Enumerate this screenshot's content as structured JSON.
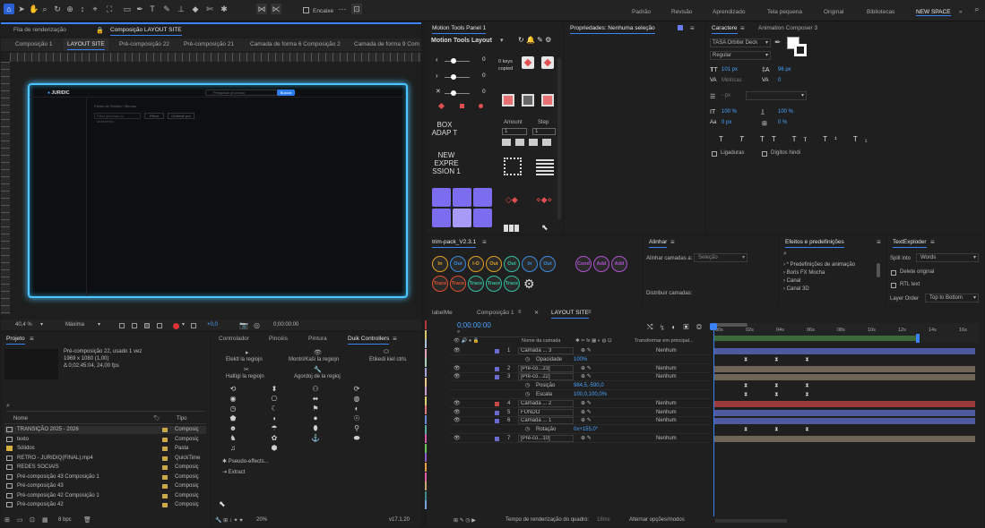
{
  "toolbar": {
    "snap_label": "Encaixe"
  },
  "workspaces": [
    "Padrão",
    "Revisão",
    "Aprendizado",
    "Tela pequena",
    "Original",
    "Bibliotecas",
    "NEW SPACE"
  ],
  "comp_panel": {
    "tabs": [
      "Fila de renderização",
      "Composição LAYOUT SITE"
    ],
    "subtabs": [
      "Composição 1",
      "LAYOUT SITE",
      "Pré-composição 22",
      "Pré-composição 21",
      "Camada de forma 6 Composição 2",
      "Camada de forma 9 Com"
    ],
    "zoom": "40,4 %",
    "resolution": "Máxima",
    "timecode": "0;00:00:00",
    "plus_value": "+0,0",
    "site": {
      "logo": "JURIDIC",
      "search_placeholder": "Pesquisar processo",
      "btn": "Buscar",
      "crumb1": "Painel de Gestão",
      "crumb2": "Minhas",
      "filter_input": "Filtrar (processo ou Andamento)",
      "filter_btn": "Filtrar",
      "order_btn": "Ordenar por"
    }
  },
  "motion_tools": {
    "tab": "Motion Tools Panel 1",
    "title": "Motion Tools Layout",
    "keys_label": "0 keys copied",
    "vals": [
      "0",
      "0",
      "0"
    ],
    "box_adapt": "BOX ADAP T",
    "new_expr": "NEW EXPRE SSION 1",
    "amount": "Amount",
    "step": "Step",
    "amount_val": "1",
    "step_val": "1"
  },
  "properties": {
    "tab": "Propriedades: Nenhuma seleção"
  },
  "character": {
    "tabs": [
      "Caractere",
      "Animation Composer 3"
    ],
    "font": "TASA Orbiter Deck",
    "style": "Regular",
    "size": "101 px",
    "leading": "96 px",
    "kerning": "Métricas",
    "tracking": "0",
    "stroke": "- px",
    "vscale": "100 %",
    "hscale": "100 %",
    "baseline": "0 px",
    "tsume": "0 %",
    "ligatures": "Ligaduras",
    "hindi": "Dígitos hindi"
  },
  "trim": {
    "tab": "trim-pack_V2.3.1",
    "buttons": [
      "In",
      "Out",
      "I-O",
      "Out",
      "Out",
      "In",
      "Out",
      "",
      "Cond",
      "Add",
      "Add",
      "Trace",
      "Trace",
      "Trace",
      "Trace",
      "Trace"
    ]
  },
  "align": {
    "tab": "Alinhar",
    "align_to_label": "Alinhar camadas a:",
    "align_to_value": "Seleção",
    "distribute": "Distribuir camadas:"
  },
  "effects": {
    "tab": "Efeitos e predefinições",
    "items": [
      "* Predefinições de animação",
      "Boris FX Mocha",
      "Canal",
      "Canal 3D"
    ]
  },
  "textexploder": {
    "tab": "TextExploder",
    "split_label": "Split into",
    "split_value": "Words",
    "delete_original": "Delete original",
    "rtl": "RTL text",
    "layer_order_label": "Layer Order",
    "layer_order_value": "Top to Bottom"
  },
  "project": {
    "tab": "Projeto",
    "selected_name": "Pré-composição 22",
    "used": ", usado 1 vez",
    "dims": "1969 x 1080 (1,00)",
    "duration": "Δ 0;02:45:04, 24,00 fps",
    "col_name": "Nome",
    "col_type": "Tipo",
    "items": [
      {
        "name": "TRANSIÇÃO 2025 - 2026",
        "type": "Composiç"
      },
      {
        "name": "texto",
        "type": "Composiç"
      },
      {
        "name": "Sólidos",
        "type": "Pasta"
      },
      {
        "name": "RETRO - JURIDIQ(FINAL).mp4",
        "type": "QuickTime"
      },
      {
        "name": "REDES SOCIAIS",
        "type": "Composiç"
      },
      {
        "name": "Pré-composição 43 Composição 1",
        "type": "Composiç"
      },
      {
        "name": "Pré-composição 43",
        "type": "Composiç"
      },
      {
        "name": "Pré-composição 42 Composição 1",
        "type": "Composiç"
      },
      {
        "name": "Pré-composição 42",
        "type": "Composiç"
      }
    ],
    "bpc": "8 bpc"
  },
  "duik": {
    "tabs": [
      "Controlador",
      "Pincéis",
      "Pintura",
      "Duik Controllers"
    ],
    "labels": [
      "Elektl la regiojn",
      "Montri/Kaŝi la regiojn",
      "Etikedi kiel ctrls",
      "Haltigi la regiojn",
      "Agordoj de la regioj"
    ],
    "list": [
      "Pseudo-effects...",
      "Extract"
    ],
    "zoom": "20%",
    "version": "v17.1.20"
  },
  "timeline": {
    "tabs": [
      "labelMe",
      "Composição 1",
      "LAYOUT SITE"
    ],
    "timecode": "0;00:00:00",
    "col_layer": "Nome da camada",
    "col_parent": "Transformar em principal...",
    "ticks": [
      "00s",
      "02s",
      "04s",
      "06s",
      "08s",
      "10s",
      "12s",
      "14s",
      "16s"
    ],
    "layers": [
      {
        "num": "1",
        "name": "Camada ... 3",
        "parent": "Nenhum"
      },
      {
        "num": "",
        "name": "Opacidade",
        "val": "100%"
      },
      {
        "num": "2",
        "name": "[Pré-co...23]",
        "parent": "Nenhum"
      },
      {
        "num": "3",
        "name": "[Pré-co...22]",
        "parent": "Nenhum"
      },
      {
        "num": "",
        "name": "Posição",
        "val": "984,5,-590,0"
      },
      {
        "num": "",
        "name": "Escala",
        "val": "100,0,100,0%"
      },
      {
        "num": "4",
        "name": "Camada ... 2",
        "parent": "Nenhum"
      },
      {
        "num": "5",
        "name": "FUNDO",
        "parent": "Nenhum"
      },
      {
        "num": "6",
        "name": "Camada ... 1",
        "parent": "Nenhum"
      },
      {
        "num": "",
        "name": "Rotação",
        "val": "0x+155,0°"
      },
      {
        "num": "7",
        "name": "[Pré-co...10]",
        "parent": "Nenhum"
      }
    ],
    "render_time_label": "Tempo de renderização do quadro:",
    "render_time_value": "18ms",
    "toggle_modes": "Alternar opções/modos"
  },
  "colors": {
    "accent": "#3b82f6",
    "neon": "#4cc4ff",
    "purple": "#7b6cf0"
  }
}
